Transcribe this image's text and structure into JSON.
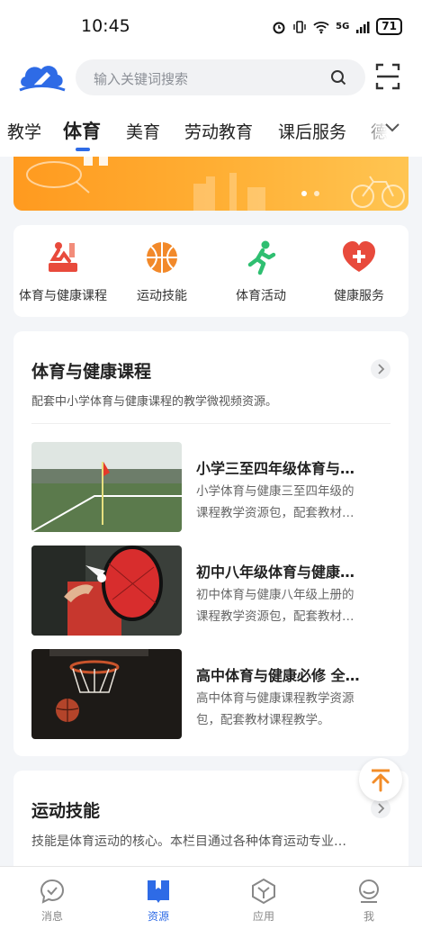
{
  "status": {
    "time": "10:45",
    "network": "5G",
    "battery": "71"
  },
  "search": {
    "placeholder": "输入关键词搜索"
  },
  "tabs": [
    {
      "label": "教学"
    },
    {
      "label": "体育",
      "active": true
    },
    {
      "label": "美育"
    },
    {
      "label": "劳动教育"
    },
    {
      "label": "课后服务"
    },
    {
      "label": "德"
    }
  ],
  "quick": [
    {
      "label": "体育与健康课程",
      "icon": "fitness-course-icon"
    },
    {
      "label": "运动技能",
      "icon": "basketball-icon"
    },
    {
      "label": "体育活动",
      "icon": "running-icon"
    },
    {
      "label": "健康服务",
      "icon": "heart-plus-icon"
    }
  ],
  "section1": {
    "title": "体育与健康课程",
    "desc": "配套中小学体育与健康课程的教学微视频资源。",
    "items": [
      {
        "title": "小学三至四年级体育与…",
        "desc1": "小学体育与健康三至四年级的",
        "desc2": "课程教学资源包，配套教材…",
        "image": "soccer-field-flag"
      },
      {
        "title": "初中八年级体育与健康…",
        "desc1": "初中体育与健康八年级上册的",
        "desc2": "课程教学资源包，配套教材…",
        "image": "badminton-racket-shuttlecock"
      },
      {
        "title": "高中体育与健康必修 全…",
        "desc1": "高中体育与健康课程教学资源",
        "desc2": "包，配套教材课程教学。",
        "image": "basketball-hoop"
      }
    ]
  },
  "section2": {
    "title": "运动技能",
    "desc": "技能是体育运动的核心。本栏目通过各种体育运动专业…"
  },
  "nav": [
    {
      "label": "消息",
      "icon": "message-icon"
    },
    {
      "label": "资源",
      "icon": "book-icon",
      "active": true
    },
    {
      "label": "应用",
      "icon": "apps-icon"
    },
    {
      "label": "我",
      "icon": "profile-icon"
    }
  ],
  "colors": {
    "accent": "#2e6be6",
    "banner": "#ffa726",
    "red_icon": "#e84a3c",
    "orange_icon": "#f2892a",
    "green_icon": "#2fbf71",
    "back_to_top": "#f28c28"
  }
}
